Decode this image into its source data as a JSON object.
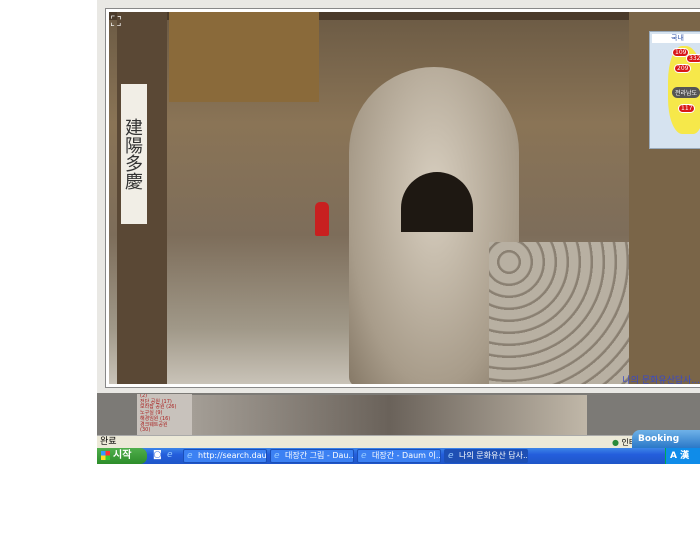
{
  "viewer": {
    "caption": "나의 문화유산답사...",
    "sign_text": "建陽多慶",
    "expand_icon": "expand-icon"
  },
  "map": {
    "tab": "국내",
    "region": "전라남도",
    "pins": [
      "109",
      "332",
      "209",
      "117"
    ]
  },
  "below_list": [
    "(2)",
    "전단 공원 (17)",
    "보라잡 공원 (26)",
    "노구실 (9)",
    "해경임원 (16)",
    "경크웨트공원",
    "(30)"
  ],
  "status": {
    "text": "완료",
    "zone": "인터넷",
    "booking": "Booking Client"
  },
  "taskbar": {
    "start": "시작",
    "tasks": [
      "http://search.dau...",
      "대장간 그림 - Dau...",
      "대장간 - Daum 이...",
      "나의 문화유산 답사..."
    ],
    "tray": "A 漢"
  }
}
